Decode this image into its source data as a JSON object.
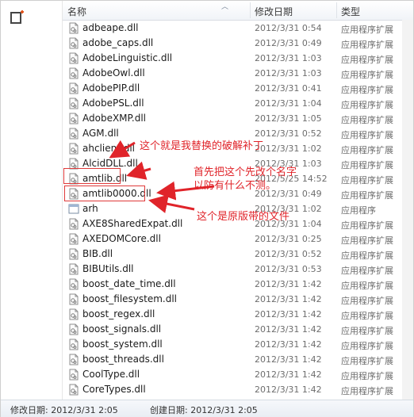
{
  "columns": {
    "name": "名称",
    "date": "修改日期",
    "type": "类型"
  },
  "files": [
    {
      "name": "adbeape.dll",
      "date": "2012/3/31 0:54",
      "type": "应用程序扩展",
      "icon": "dll-file-icon"
    },
    {
      "name": "adobe_caps.dll",
      "date": "2012/3/31 0:49",
      "type": "应用程序扩展",
      "icon": "dll-file-icon"
    },
    {
      "name": "AdobeLinguistic.dll",
      "date": "2012/3/31 1:03",
      "type": "应用程序扩展",
      "icon": "dll-file-icon"
    },
    {
      "name": "AdobeOwl.dll",
      "date": "2012/3/31 1:03",
      "type": "应用程序扩展",
      "icon": "dll-file-icon"
    },
    {
      "name": "AdobePIP.dll",
      "date": "2012/3/31 0:41",
      "type": "应用程序扩展",
      "icon": "dll-file-icon"
    },
    {
      "name": "AdobePSL.dll",
      "date": "2012/3/31 1:04",
      "type": "应用程序扩展",
      "icon": "dll-file-icon"
    },
    {
      "name": "AdobeXMP.dll",
      "date": "2012/3/31 1:05",
      "type": "应用程序扩展",
      "icon": "dll-file-icon"
    },
    {
      "name": "AGM.dll",
      "date": "2012/3/31 0:52",
      "type": "应用程序扩展",
      "icon": "dll-file-icon"
    },
    {
      "name": "ahclient.dll",
      "date": "2012/3/31 1:02",
      "type": "应用程序扩展",
      "icon": "dll-file-icon"
    },
    {
      "name": "AlcidDLL.dll",
      "date": "2012/3/31 1:03",
      "type": "应用程序扩展",
      "icon": "dll-file-icon"
    },
    {
      "name": "amtlib.dll",
      "date": "2012/5/25 14:52",
      "type": "应用程序扩展",
      "icon": "dll-file-icon"
    },
    {
      "name": "amtlib0000.dll",
      "date": "2012/3/31 0:49",
      "type": "应用程序扩展",
      "icon": "dll-file-icon"
    },
    {
      "name": "arh",
      "date": "2012/3/31 1:02",
      "type": "应用程序",
      "icon": "exe-file-icon"
    },
    {
      "name": "AXE8SharedExpat.dll",
      "date": "2012/3/31 1:04",
      "type": "应用程序扩展",
      "icon": "dll-file-icon"
    },
    {
      "name": "AXEDOMCore.dll",
      "date": "2012/3/31 0:25",
      "type": "应用程序扩展",
      "icon": "dll-file-icon"
    },
    {
      "name": "BIB.dll",
      "date": "2012/3/31 0:52",
      "type": "应用程序扩展",
      "icon": "dll-file-icon"
    },
    {
      "name": "BIBUtils.dll",
      "date": "2012/3/31 0:53",
      "type": "应用程序扩展",
      "icon": "dll-file-icon"
    },
    {
      "name": "boost_date_time.dll",
      "date": "2012/3/31 1:42",
      "type": "应用程序扩展",
      "icon": "dll-file-icon"
    },
    {
      "name": "boost_filesystem.dll",
      "date": "2012/3/31 1:42",
      "type": "应用程序扩展",
      "icon": "dll-file-icon"
    },
    {
      "name": "boost_regex.dll",
      "date": "2012/3/31 1:42",
      "type": "应用程序扩展",
      "icon": "dll-file-icon"
    },
    {
      "name": "boost_signals.dll",
      "date": "2012/3/31 1:42",
      "type": "应用程序扩展",
      "icon": "dll-file-icon"
    },
    {
      "name": "boost_system.dll",
      "date": "2012/3/31 1:42",
      "type": "应用程序扩展",
      "icon": "dll-file-icon"
    },
    {
      "name": "boost_threads.dll",
      "date": "2012/3/31 1:42",
      "type": "应用程序扩展",
      "icon": "dll-file-icon"
    },
    {
      "name": "CoolType.dll",
      "date": "2012/3/31 1:42",
      "type": "应用程序扩展",
      "icon": "dll-file-icon"
    },
    {
      "name": "CoreTypes.dll",
      "date": "2012/3/31 1:42",
      "type": "应用程序扩展",
      "icon": "dll-file-icon"
    }
  ],
  "annotations": {
    "crack": "这个就是我替换的破解补丁",
    "rename_line1": "首先把这个先改个名字",
    "rename_line2": "以防有什么不测。",
    "original": "这个是原版带的文件"
  },
  "status": {
    "modified": "修改日期: 2012/3/31 2:05",
    "created": "创建日期: 2012/3/31 2:05"
  },
  "colors": {
    "annotation": "#e0242a",
    "header_bg": "#f1f4f8"
  }
}
